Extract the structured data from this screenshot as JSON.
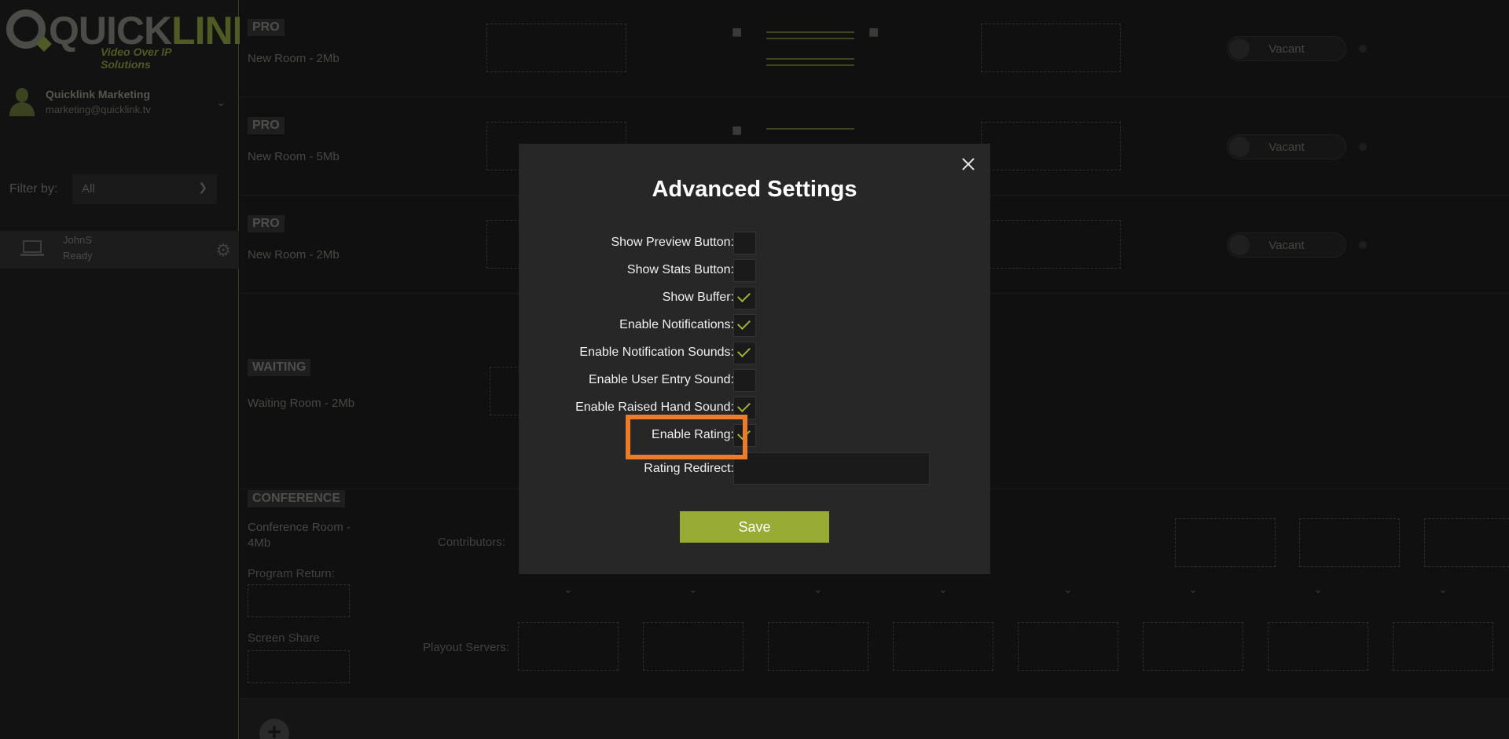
{
  "brand": {
    "logo_left": "Q",
    "logo_word_quick": "QUICK",
    "logo_word_link": "LINK",
    "tagline": "Video Over IP Solutions"
  },
  "user": {
    "name": "Quicklink Marketing",
    "email": "marketing@quicklink.tv"
  },
  "filter": {
    "label": "Filter by:",
    "selected": "All"
  },
  "device": {
    "name": "JohnS",
    "status": "Ready"
  },
  "rooms": [
    {
      "badge": "PRO",
      "name": "New Room - 2Mb",
      "status": "Vacant"
    },
    {
      "badge": "PRO",
      "name": "New Room - 5Mb",
      "status": "Vacant"
    },
    {
      "badge": "PRO",
      "name": "New Room - 2Mb",
      "status": "Vacant"
    }
  ],
  "waiting": {
    "badge": "WAITING",
    "name": "Waiting Room - 2Mb"
  },
  "conference": {
    "badge": "CONFERENCE",
    "name": "Conference Room - 4Mb",
    "contributors_label": "Contributors:",
    "program_return_label": "Program Return:",
    "screen_share_label": "Screen Share",
    "playout_label": "Playout Servers:"
  },
  "modal": {
    "title": "Advanced Settings",
    "settings": [
      {
        "label": "Show Preview Button:",
        "checked": false
      },
      {
        "label": "Show Stats Button:",
        "checked": false
      },
      {
        "label": "Show Buffer:",
        "checked": true
      },
      {
        "label": "Enable Notifications:",
        "checked": true
      },
      {
        "label": "Enable Notification Sounds:",
        "checked": true
      },
      {
        "label": "Enable User Entry Sound:",
        "checked": false
      },
      {
        "label": "Enable Raised Hand Sound:",
        "checked": true
      },
      {
        "label": "Enable Rating:",
        "checked": true
      }
    ],
    "rating_redirect_label": "Rating Redirect:",
    "rating_redirect_value": "",
    "save_label": "Save"
  },
  "colors": {
    "accent": "#97ab35",
    "highlight": "#ec7b2a"
  }
}
